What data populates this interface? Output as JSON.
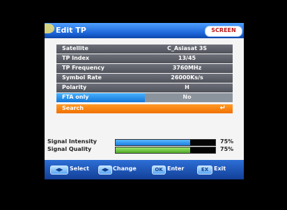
{
  "window": {
    "title": "Edit TP",
    "brand_badge": "SCREEN"
  },
  "fields": [
    {
      "label": "Satellite",
      "value": "C_Asiasat 3S"
    },
    {
      "label": "TP Index",
      "value": "13/45"
    },
    {
      "label": "TP Frequency",
      "value": "3760MHz"
    },
    {
      "label": "Symbol Rate",
      "value": "26000Ks/s"
    },
    {
      "label": "Polarity",
      "value": "H"
    }
  ],
  "fta": {
    "label": "FTA only",
    "value": "No"
  },
  "search": {
    "label": "Search",
    "icon": "enter-arrow-icon"
  },
  "signal": {
    "intensity": {
      "label": "Signal Intensity",
      "percent_text": "75%",
      "percent": 0.75
    },
    "quality": {
      "label": "Signal Quality",
      "percent_text": "75%",
      "percent": 0.75
    }
  },
  "footer": {
    "select": "Select",
    "change": "Change",
    "enter": "Enter",
    "exit": "Exit"
  },
  "colors": {
    "title_blue": "#1a63d6",
    "field_gray": "#50535b",
    "fta_blue": "#1377d7",
    "search_orange": "#f07000",
    "footer_blue": "#123f98"
  }
}
